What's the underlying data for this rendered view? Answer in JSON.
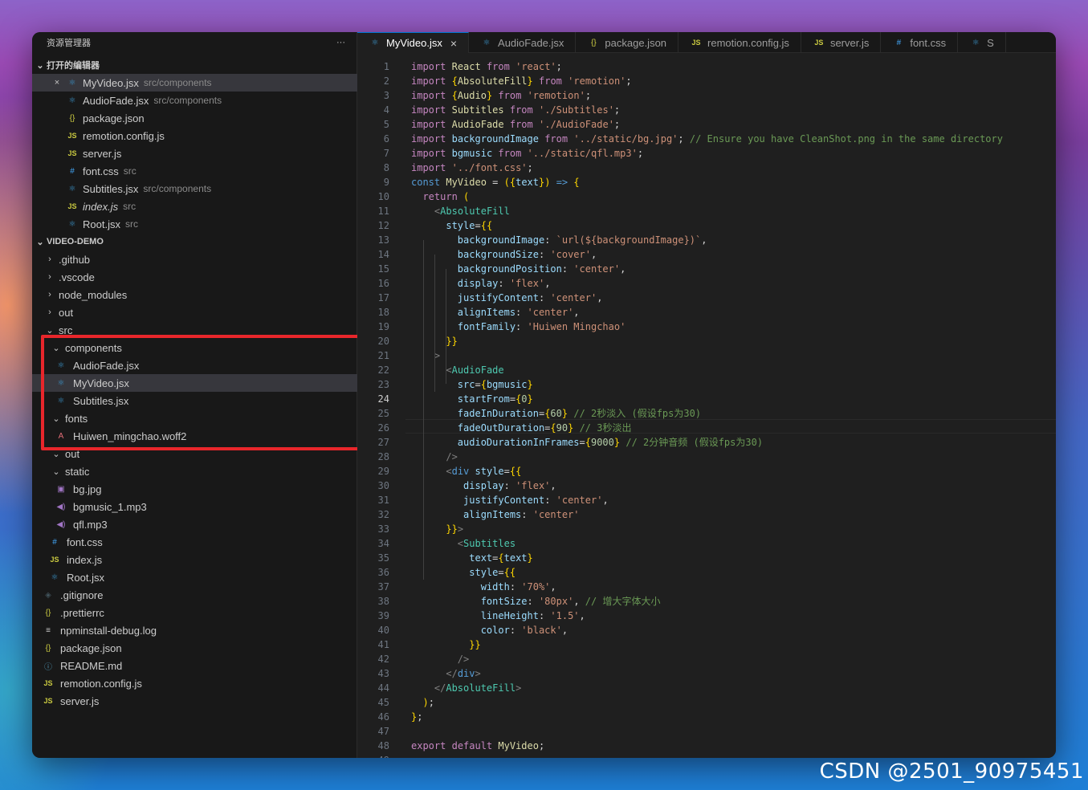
{
  "explorer": {
    "title": "资源管理器",
    "more": "···",
    "open_editors_header": "打开的编辑器",
    "open_editors": [
      {
        "name": "MyVideo.jsx",
        "desc": "src/components",
        "icon": "react-icon",
        "close": "×",
        "selected": true
      },
      {
        "name": "AudioFade.jsx",
        "desc": "src/components",
        "icon": "react-icon"
      },
      {
        "name": "package.json",
        "desc": "",
        "icon": "json-icon"
      },
      {
        "name": "remotion.config.js",
        "desc": "",
        "icon": "js-icon"
      },
      {
        "name": "server.js",
        "desc": "",
        "icon": "js-icon"
      },
      {
        "name": "font.css",
        "desc": "src",
        "icon": "css-icon"
      },
      {
        "name": "Subtitles.jsx",
        "desc": "src/components",
        "icon": "react-icon"
      },
      {
        "name": "index.js",
        "desc": "src",
        "icon": "js-icon",
        "italic": true
      },
      {
        "name": "Root.jsx",
        "desc": "src",
        "icon": "react-icon"
      }
    ],
    "project_header": "VIDEO-DEMO",
    "tree": [
      {
        "name": ".github",
        "indent": 1,
        "chev": "›"
      },
      {
        "name": ".vscode",
        "indent": 1,
        "chev": "›"
      },
      {
        "name": "node_modules",
        "indent": 1,
        "chev": "›"
      },
      {
        "name": "out",
        "indent": 1,
        "chev": "›"
      },
      {
        "name": "src",
        "indent": 1,
        "chev": "⌄"
      },
      {
        "name": "components",
        "indent": 2,
        "chev": "⌄"
      },
      {
        "name": "AudioFade.jsx",
        "indent": 3,
        "icon": "react-icon"
      },
      {
        "name": "MyVideo.jsx",
        "indent": 3,
        "icon": "react-icon",
        "selected": true
      },
      {
        "name": "Subtitles.jsx",
        "indent": 3,
        "icon": "react-icon"
      },
      {
        "name": "fonts",
        "indent": 2,
        "chev": "⌄"
      },
      {
        "name": "Huiwen_mingchao.woff2",
        "indent": 3,
        "icon": "font-icon"
      },
      {
        "name": "out",
        "indent": 2,
        "chev": "⌄"
      },
      {
        "name": "static",
        "indent": 2,
        "chev": "⌄"
      },
      {
        "name": "bg.jpg",
        "indent": 3,
        "icon": "image-icon"
      },
      {
        "name": "bgmusic_1.mp3",
        "indent": 3,
        "icon": "audio-icon"
      },
      {
        "name": "qfl.mp3",
        "indent": 3,
        "icon": "audio-icon"
      },
      {
        "name": "font.css",
        "indent": 2,
        "icon": "css-icon"
      },
      {
        "name": "index.js",
        "indent": 2,
        "icon": "js-icon"
      },
      {
        "name": "Root.jsx",
        "indent": 2,
        "icon": "react-icon"
      },
      {
        "name": ".gitignore",
        "indent": 1,
        "icon": "git-icon"
      },
      {
        "name": ".prettierrc",
        "indent": 1,
        "icon": "json-icon"
      },
      {
        "name": "npminstall-debug.log",
        "indent": 1,
        "icon": "log-icon"
      },
      {
        "name": "package.json",
        "indent": 1,
        "icon": "json-icon"
      },
      {
        "name": "README.md",
        "indent": 1,
        "icon": "info-icon"
      },
      {
        "name": "remotion.config.js",
        "indent": 1,
        "icon": "js-icon"
      },
      {
        "name": "server.js",
        "indent": 1,
        "icon": "js-icon"
      }
    ]
  },
  "tabs": [
    {
      "label": "MyVideo.jsx",
      "icon": "react-icon",
      "active": true,
      "close": "×"
    },
    {
      "label": "AudioFade.jsx",
      "icon": "react-icon"
    },
    {
      "label": "package.json",
      "icon": "json-icon"
    },
    {
      "label": "remotion.config.js",
      "icon": "js-icon"
    },
    {
      "label": "server.js",
      "icon": "js-icon"
    },
    {
      "label": "font.css",
      "icon": "css-icon"
    },
    {
      "label": "S",
      "icon": "react-icon"
    }
  ],
  "icons": {
    "react-icon": "⚛",
    "js-icon": "JS",
    "json-icon": "{}",
    "css-icon": "#",
    "image-icon": "▣",
    "audio-icon": "◀)",
    "font-icon": "A",
    "git-icon": "◈",
    "log-icon": "≡",
    "info-icon": "ⓘ"
  },
  "editor": {
    "current_line": 24,
    "lines": [
      "import React from 'react';",
      "import {AbsoluteFill} from 'remotion';",
      "import {Audio} from 'remotion';",
      "import Subtitles from './Subtitles';",
      "import AudioFade from './AudioFade';",
      "import backgroundImage from '../static/bg.jpg'; // Ensure you have CleanShot.png in the same directory",
      "import bgmusic from '../static/qfl.mp3';",
      "import '../font.css';",
      "const MyVideo = ({text}) => {",
      "  return (",
      "    <AbsoluteFill",
      "      style={{",
      "        backgroundImage: `url(${backgroundImage})`,",
      "        backgroundSize: 'cover',",
      "        backgroundPosition: 'center',",
      "        display: 'flex',",
      "        justifyContent: 'center',",
      "        alignItems: 'center',",
      "        fontFamily: 'Huiwen Mingchao'",
      "      }}",
      "    >",
      "      <AudioFade",
      "        src={bgmusic}",
      "        startFrom={0}",
      "        fadeInDuration={60} // 2秒淡入 (假设fps为30)",
      "        fadeOutDuration={90} // 3秒淡出",
      "        audioDurationInFrames={9000} // 2分钟音频 (假设fps为30)",
      "      />",
      "      <div style={{",
      "         display: 'flex',",
      "         justifyContent: 'center',",
      "         alignItems: 'center'",
      "      }}>",
      "        <Subtitles",
      "          text={text}",
      "          style={{",
      "            width: '70%',",
      "            fontSize: '80px', // 增大字体大小",
      "            lineHeight: '1.5',",
      "            color: 'black',",
      "          }}",
      "        />",
      "      </div>",
      "    </AbsoluteFill>",
      "  );",
      "};",
      "",
      "export default MyVideo;",
      ""
    ]
  },
  "watermark": "CSDN @2501_90975451"
}
